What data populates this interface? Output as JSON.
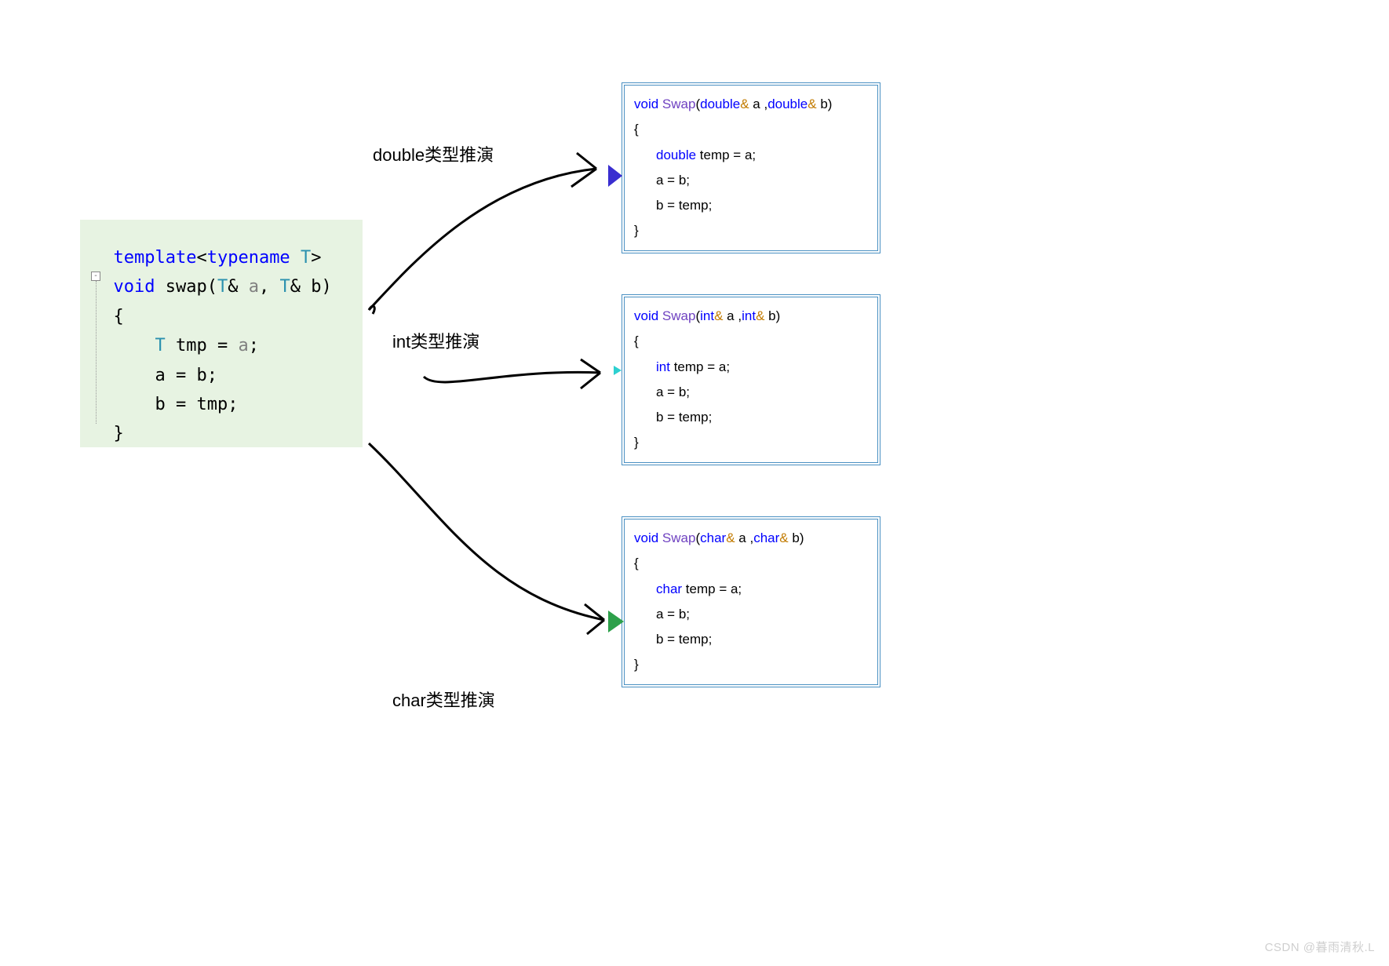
{
  "template": {
    "line1_kw": "template",
    "line1_tn": "typename",
    "line1_T": "T",
    "line2_void": "void",
    "line2_fn": "swap",
    "line2_T1": "T",
    "line2_a": "a",
    "line2_T2": "T",
    "line2_b": "b",
    "brace_open": "{",
    "body1_T": "T",
    "body1_rest": " tmp = ",
    "body1_a": "a",
    "body1_semi": ";",
    "body2": "a = b;",
    "body3": "b = tmp;",
    "brace_close": "}",
    "gutter": "-"
  },
  "labels": {
    "double": "double类型推演",
    "int": "int类型推演",
    "char": "char类型推演"
  },
  "instances": [
    {
      "void": "void",
      "func": "Swap",
      "type": "double",
      "a": "a",
      "b": "b",
      "brace_open": "{",
      "body1": "double temp = a;",
      "body2": "a = b;",
      "body3": "b = temp;",
      "brace_close": "}",
      "body_type": "double"
    },
    {
      "void": "void",
      "func": "Swap",
      "type": "int",
      "a": "a",
      "b": "b",
      "brace_open": "{",
      "body1": "int temp = a;",
      "body2": "a = b;",
      "body3": "b = temp;",
      "brace_close": "}",
      "body_type": "int"
    },
    {
      "void": "void",
      "func": "Swap",
      "type": "char",
      "a": "a",
      "b": "b",
      "brace_open": "{",
      "body1": "char temp = a;",
      "body2": "a = b;",
      "body3": "b = temp;",
      "brace_close": "}",
      "body_type": "char"
    }
  ],
  "watermark": "CSDN @暮雨清秋.L"
}
